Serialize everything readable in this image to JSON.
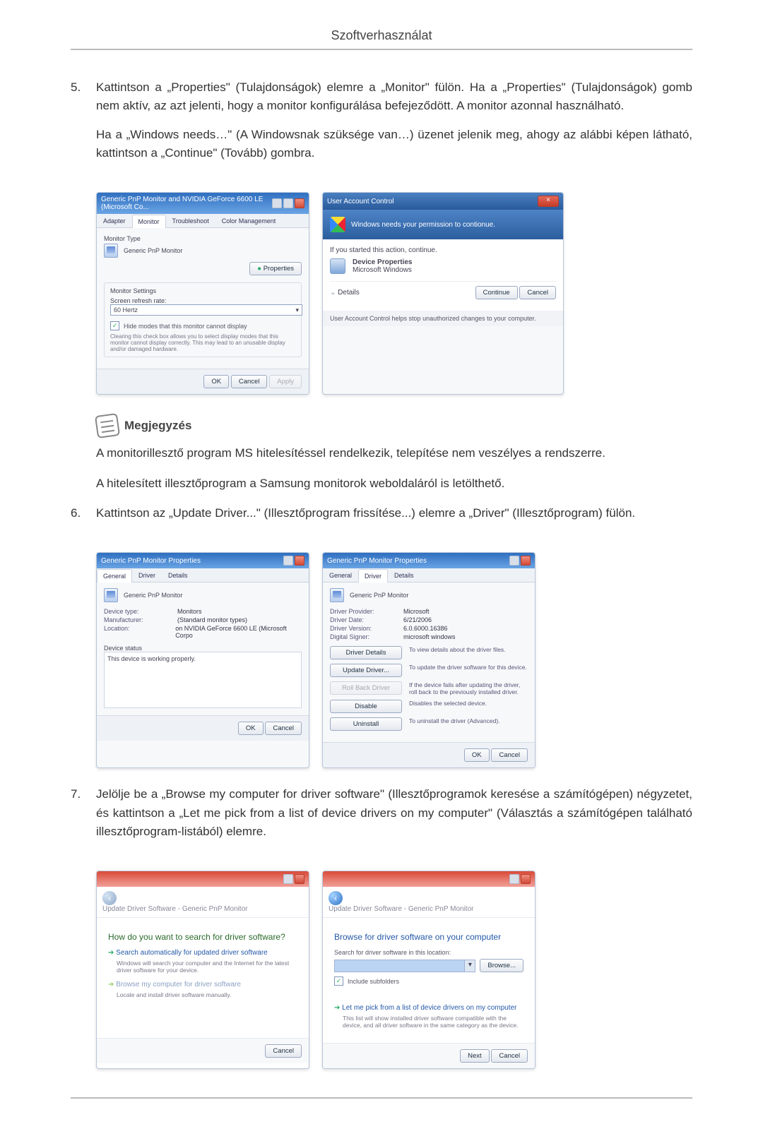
{
  "page_title": "Szoftverhasználat",
  "steps": {
    "5": {
      "num": "5.",
      "p1": "Kattintson a „Properties\" (Tulajdonságok) elemre a „Monitor\" fülön. Ha a „Properties\" (Tulajdonságok) gomb nem aktív, az azt jelenti, hogy a monitor konfigurálása befejeződött. A monitor azonnal használható.",
      "p2": "Ha a „Windows needs…\" (A Windowsnak szüksége van…) üzenet jelenik meg, ahogy az alábbi képen látható, kattintson a „Continue\" (Tovább) gombra."
    },
    "6": {
      "num": "6.",
      "p1": "Kattintson az „Update Driver...\" (Illesztőprogram frissítése...) elemre a „Driver\" (Illesztőprogram) fülön."
    },
    "7": {
      "num": "7.",
      "p1": "Jelölje be a „Browse my computer for driver software\" (Illesztőprogramok keresése a számítógépen) négyzetet, és kattintson a „Let me pick from a list of device drivers on my computer\" (Választás a számítógépen található illesztőprogram-listából) elemre."
    }
  },
  "note": {
    "title": "Megjegyzés",
    "p1": "A monitorillesztő program MS hitelesítéssel rendelkezik, telepítése nem veszélyes a rendszerre.",
    "p2": "A hitelesített illesztőprogram a Samsung monitorok weboldaláról is letölthető."
  },
  "dlgA": {
    "title": "Generic PnP Monitor and NVIDIA GeForce 6600 LE (Microsoft Co...",
    "tabs": {
      "adapter": "Adapter",
      "monitor": "Monitor",
      "troubleshoot": "Troubleshoot",
      "color": "Color Management"
    },
    "monitor_type_label": "Monitor Type",
    "monitor_name": "Generic PnP Monitor",
    "properties_btn": "Properties",
    "settings_label": "Monitor Settings",
    "refresh_label": "Screen refresh rate:",
    "refresh_value": "60 Hertz",
    "hide_modes": "Hide modes that this monitor cannot display",
    "hide_modes_desc": "Clearing this check box allows you to select display modes that this monitor cannot display correctly. This may lead to an unusable display and/or damaged hardware.",
    "ok": "OK",
    "cancel": "Cancel",
    "apply": "Apply"
  },
  "dlgB": {
    "title": "User Account Control",
    "headline": "Windows needs your permission to contionue.",
    "if_started": "If you started this action, continue.",
    "dev_prop": "Device Properties",
    "ms_windows": "Microsoft Windows",
    "details": "Details",
    "continue": "Continue",
    "cancel": "Cancel",
    "footer": "User Account Control helps stop unauthorized changes to your computer."
  },
  "dlgC": {
    "title": "Generic PnP Monitor Properties",
    "tabs": {
      "general": "General",
      "driver": "Driver",
      "details": "Details"
    },
    "name": "Generic PnP Monitor",
    "devtype_k": "Device type:",
    "devtype_v": "Monitors",
    "mfr_k": "Manufacturer:",
    "mfr_v": "(Standard monitor types)",
    "loc_k": "Location:",
    "loc_v": "on NVIDIA GeForce 6600 LE (Microsoft Corpo",
    "status_label": "Device status",
    "status_text": "This device is working properly.",
    "ok": "OK",
    "cancel": "Cancel"
  },
  "dlgD": {
    "title": "Generic PnP Monitor Properties",
    "tabs": {
      "general": "General",
      "driver": "Driver",
      "details": "Details"
    },
    "name": "Generic PnP Monitor",
    "provider_k": "Driver Provider:",
    "provider_v": "Microsoft",
    "date_k": "Driver Date:",
    "date_v": "6/21/2006",
    "version_k": "Driver Version:",
    "version_v": "6.0.6000.16386",
    "signer_k": "Digital Signer:",
    "signer_v": "microsoft windows",
    "btn_details": "Driver Details",
    "desc_details": "To view details about the driver files.",
    "btn_update": "Update Driver...",
    "desc_update": "To update the driver software for this device.",
    "btn_rollback": "Roll Back Driver",
    "desc_rollback": "If the device fails after updating the driver, roll back to the previously installed driver.",
    "btn_disable": "Disable",
    "desc_disable": "Disables the selected device.",
    "btn_uninstall": "Uninstall",
    "desc_uninstall": "To uninstall the driver (Advanced).",
    "ok": "OK",
    "cancel": "Cancel"
  },
  "dlgE": {
    "crumb": "Update Driver Software - Generic PnP Monitor",
    "heading": "How do you want to search for driver software?",
    "opt1": "Search automatically for updated driver software",
    "opt1_desc": "Windows will search your computer and the Internet for the latest driver software for your device.",
    "opt2": "Browse my computer for driver software",
    "opt2_desc": "Locate and install driver software manually.",
    "cancel": "Cancel"
  },
  "dlgF": {
    "crumb": "Update Driver Software - Generic PnP Monitor",
    "heading": "Browse for driver software on your computer",
    "search_label": "Search for driver software in this location:",
    "browse": "Browse...",
    "include": "Include subfolders",
    "opt": "Let me pick from a list of device drivers on my computer",
    "opt_desc": "This list will show installed driver software compatible with the device, and all driver software in the same category as the device.",
    "next": "Next",
    "cancel": "Cancel"
  }
}
